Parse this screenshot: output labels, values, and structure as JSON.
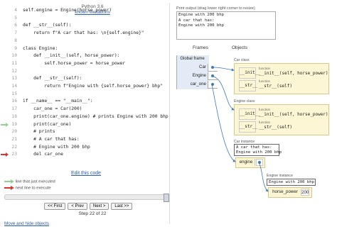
{
  "header": {
    "language": "Python 3.6",
    "limitations_link": "known limitations"
  },
  "code_lines": [
    {
      "num": "4",
      "text": "self.engine = Engine(horse_power)",
      "marker": ""
    },
    {
      "num": "5",
      "text": "",
      "marker": ""
    },
    {
      "num": "6",
      "text": "def __str__(self):",
      "marker": ""
    },
    {
      "num": "7",
      "text": "    return f\"A car that has: \\n{self.engine}\"",
      "marker": ""
    },
    {
      "num": "8",
      "text": "",
      "marker": ""
    },
    {
      "num": "9",
      "text": "class Engine:",
      "marker": ""
    },
    {
      "num": "10",
      "text": "    def __init__(self, horse_power):",
      "marker": ""
    },
    {
      "num": "11",
      "text": "        self.horse_power = horse_power",
      "marker": ""
    },
    {
      "num": "12",
      "text": "",
      "marker": ""
    },
    {
      "num": "13",
      "text": "    def __str__(self):",
      "marker": ""
    },
    {
      "num": "14",
      "text": "        return f\"Engine with {self.horse_power} bhp\"",
      "marker": ""
    },
    {
      "num": "15",
      "text": "",
      "marker": ""
    },
    {
      "num": "16",
      "text": "if __name__ == \"__main__\":",
      "marker": ""
    },
    {
      "num": "17",
      "text": "    car_one = Car(200)",
      "marker": ""
    },
    {
      "num": "18",
      "text": "    print(car_one.engine) # prints Engine with 200 bhp",
      "marker": ""
    },
    {
      "num": "19",
      "text": "    print(car_one)",
      "marker": "prev"
    },
    {
      "num": "20",
      "text": "    # prints",
      "marker": ""
    },
    {
      "num": "21",
      "text": "    # A car that has:",
      "marker": ""
    },
    {
      "num": "22",
      "text": "    # Engine with 200 bhp",
      "marker": ""
    },
    {
      "num": "23",
      "text": "    del car_one",
      "marker": "next"
    }
  ],
  "edit_link": "Edit this code",
  "legend": {
    "prev": "line that just executed",
    "next": "next line to execute"
  },
  "nav": {
    "first": "<< First",
    "back": "< Prev",
    "forward": "Next >",
    "last": "Last >>"
  },
  "step_text": "Step 22 of 22",
  "move_link": "Move and hide objects",
  "output": {
    "label": "Print output (drag lower right corner to resize)",
    "text": "Engine with 200 bhp\nA car that has:\nEngine with 200 bhp"
  },
  "frames_header": "Frames",
  "objects_header": "Objects",
  "global_frame": {
    "title": "Global frame",
    "vars": [
      "Car",
      "Engine",
      "car_one"
    ]
  },
  "car_class": {
    "label": "Car class",
    "methods": [
      {
        "key": "__init__",
        "type": "function",
        "sig": "__init__(self, horse_power)"
      },
      {
        "key": "__str__",
        "type": "function",
        "sig": "__str__(self)"
      }
    ]
  },
  "engine_class": {
    "label": "Engine class",
    "methods": [
      {
        "key": "__init__",
        "type": "function",
        "sig": "__init__(self, horse_power)"
      },
      {
        "key": "__str__",
        "type": "function",
        "sig": "__str__(self)"
      }
    ]
  },
  "car_instance": {
    "label": "Car instance",
    "str_popup": "A car that has:\nEngine with 200 bhp",
    "attr": "engine"
  },
  "engine_instance": {
    "label": "Engine instance",
    "str_popup": "Engine with 200 bhp",
    "attr": "horse_power",
    "value": "200"
  },
  "colors": {
    "link": "#2a5db0",
    "prev_arrow": "#8fd18f",
    "next_arrow": "#d9362b",
    "class_bg": "#fdf6d4",
    "frame_bg": "#e2ebf6"
  }
}
